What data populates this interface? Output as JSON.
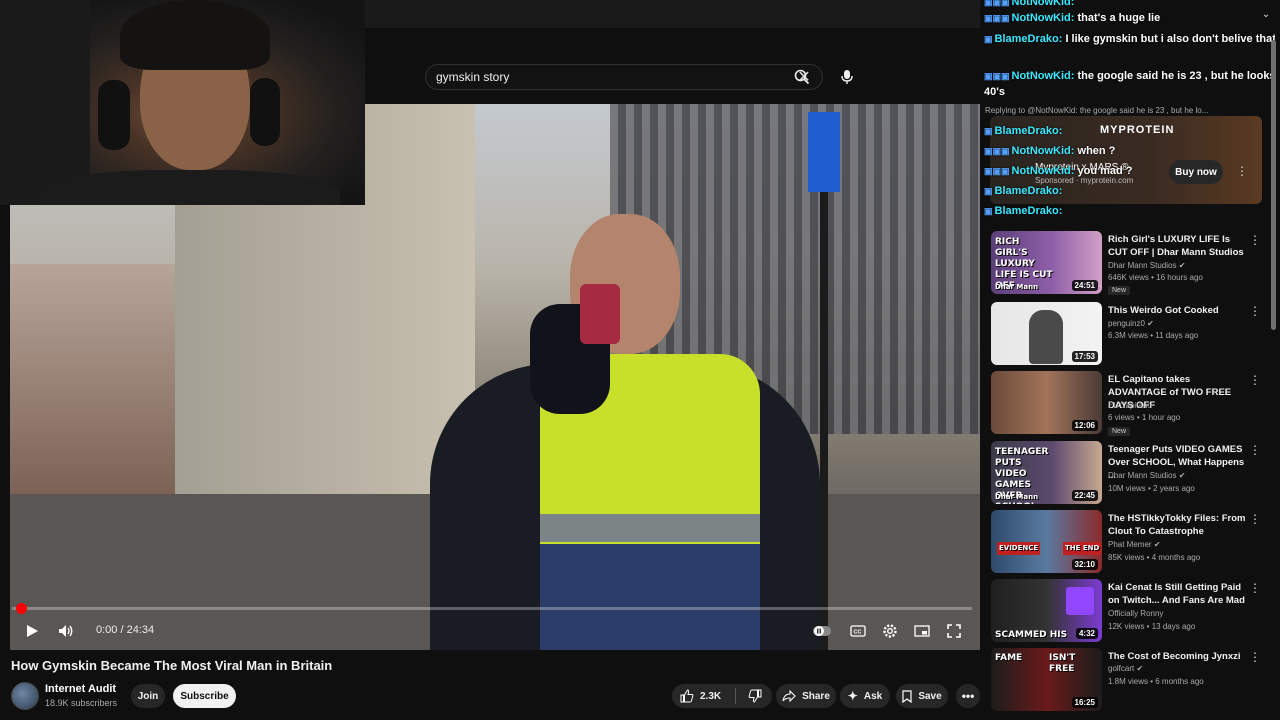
{
  "search": {
    "query": "gymskin story",
    "clear_icon": "close-icon",
    "search_icon": "search-icon",
    "mic_icon": "microphone-icon"
  },
  "player": {
    "time": "0:00 / 24:34",
    "progress": 0,
    "controls": [
      "play-icon",
      "volume-icon",
      "pause-autoplay-icon",
      "captions-icon",
      "settings-icon",
      "miniplayer-icon",
      "fullscreen-icon"
    ]
  },
  "video": {
    "title": "How Gymskin Became The Most Viral Man in Britain",
    "channel": "Internet Audit",
    "subscribers": "18.9K subscribers",
    "join_label": "Join",
    "subscribe_label": "Subscribe",
    "likes": "2.3K",
    "share_label": "Share",
    "ask_label": "Ask",
    "save_label": "Save"
  },
  "chat": {
    "lines": [
      {
        "user": "NotNowKid:",
        "text": ""
      },
      {
        "user": "NotNowKid:",
        "text": "that's a huge lie"
      },
      {
        "user": "BlameDrako:",
        "text": "I like gymskin but i also don't belive that"
      },
      {
        "user": "NotNowKid:",
        "text": "the google said he is 23 , but he looks 40's"
      },
      {
        "user": "BlameDrako:",
        "text": ""
      },
      {
        "user": "NotNowKid:",
        "text": "when ?"
      },
      {
        "user": "NotNowKid:",
        "text": "you mad ?"
      },
      {
        "user": "BlameDrako:",
        "text": ""
      },
      {
        "user": "BlameDrako:",
        "text": ""
      }
    ],
    "reply": "Replying to @NotNowKid: the google said he is 23 , but he lo..."
  },
  "ad": {
    "brand": "MYPROTEIN",
    "title": "Myprotein x MARS ®",
    "sponsor": "Sponsored · myprotein.com",
    "cta": "Buy now"
  },
  "recommendations": [
    {
      "title": "Rich Girl's LUXURY LIFE Is CUT OFF | Dhar Mann Studios",
      "channel": "Dhar Mann Studios",
      "meta": "646K views • 16 hours ago",
      "badge": "New",
      "duration": "24:51",
      "thumb_text": "RICH GIRL'S LUXURY LIFE IS CUT OFF",
      "thumb_sub": "Dhar Mann"
    },
    {
      "title": "This Weirdo Got Cooked",
      "channel": "penguinz0",
      "meta": "6.3M views • 11 days ago",
      "badge": "",
      "duration": "17:53",
      "thumb_text": "",
      "thumb_sub": ""
    },
    {
      "title": "EL Capitano takes ADVANTAGE of TWO FREE DAYS OFF",
      "channel": "EL Capitano",
      "meta": "6 views • 1 hour ago",
      "badge": "New",
      "duration": "12:06",
      "thumb_text": "",
      "thumb_sub": ""
    },
    {
      "title": "Teenager Puts VIDEO GAMES Over SCHOOL, What Happens ...",
      "channel": "Dhar Mann Studios",
      "meta": "10M views • 2 years ago",
      "badge": "",
      "duration": "22:45",
      "thumb_text": "TEENAGER PUTS VIDEO GAMES OVER SCHOOL",
      "thumb_sub": "Dhar Mann"
    },
    {
      "title": "The HSTikkyTokky Files: From Clout To Catastrophe",
      "channel": "Phat Memer",
      "meta": "85K views • 4 months ago",
      "badge": "",
      "duration": "32:10",
      "thumb_text": "EVIDENCE",
      "thumb_sub": "THE END"
    },
    {
      "title": "Kai Cenat Is Still Getting Paid on Twitch... And Fans Are Mad",
      "channel": "Officially Ronny",
      "meta": "12K views • 13 days ago",
      "badge": "",
      "duration": "4:32",
      "thumb_text": "SCAMMED HIS",
      "thumb_sub": ""
    },
    {
      "title": "The Cost of Becoming Jynxzi",
      "channel": "golfcart",
      "meta": "1.8M views • 6 months ago",
      "badge": "",
      "duration": "16:25",
      "thumb_text": "FAME",
      "thumb_sub": "ISN'T FREE"
    }
  ]
}
